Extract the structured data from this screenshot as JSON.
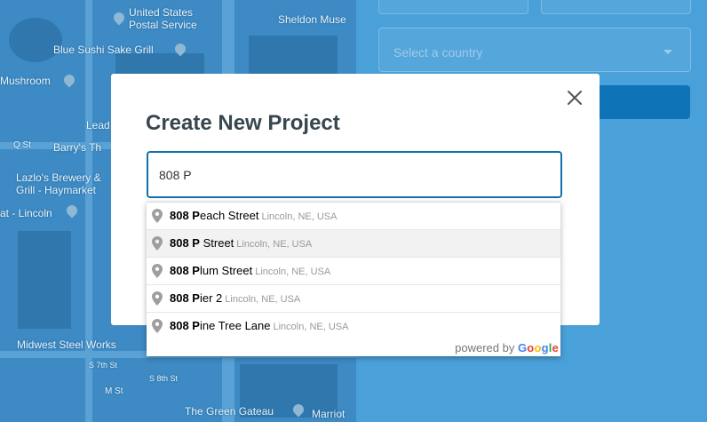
{
  "map": {
    "labels": [
      {
        "text": "United States"
      },
      {
        "text": "Postal Service"
      },
      {
        "text": "Sheldon Muse"
      },
      {
        "text": "Blue Sushi Sake Grill"
      },
      {
        "text": "Mushroom"
      },
      {
        "text": "Lead"
      },
      {
        "text": "Q St"
      },
      {
        "text": "Barry's Th"
      },
      {
        "text": "Lazlo's Brewery &"
      },
      {
        "text": "Grill - Haymarket"
      },
      {
        "text": "at - Lincoln"
      },
      {
        "text": "Midwest Steel Works"
      },
      {
        "text": "S 7th St"
      },
      {
        "text": "S 8th St"
      },
      {
        "text": "M St"
      },
      {
        "text": "The Green Gateau"
      },
      {
        "text": "Marriot"
      }
    ]
  },
  "background_form": {
    "country_placeholder": "Select a country"
  },
  "modal": {
    "title": "Create New Project",
    "address_value": "808 P",
    "close_icon": "close-icon"
  },
  "autocomplete": {
    "items": [
      {
        "match": "808 P",
        "rest": "each Street",
        "secondary": "Lincoln, NE, USA"
      },
      {
        "match": "808 P",
        "rest": " Street",
        "secondary": "Lincoln, NE, USA"
      },
      {
        "match": "808 P",
        "rest": "lum Street",
        "secondary": "Lincoln, NE, USA"
      },
      {
        "match": "808 P",
        "rest": "ier 2",
        "secondary": "Lincoln, NE, USA"
      },
      {
        "match": "808 P",
        "rest": "ine Tree Lane",
        "secondary": "Lincoln, NE, USA"
      }
    ],
    "footer_text": "powered by",
    "footer_brand": "Google"
  }
}
